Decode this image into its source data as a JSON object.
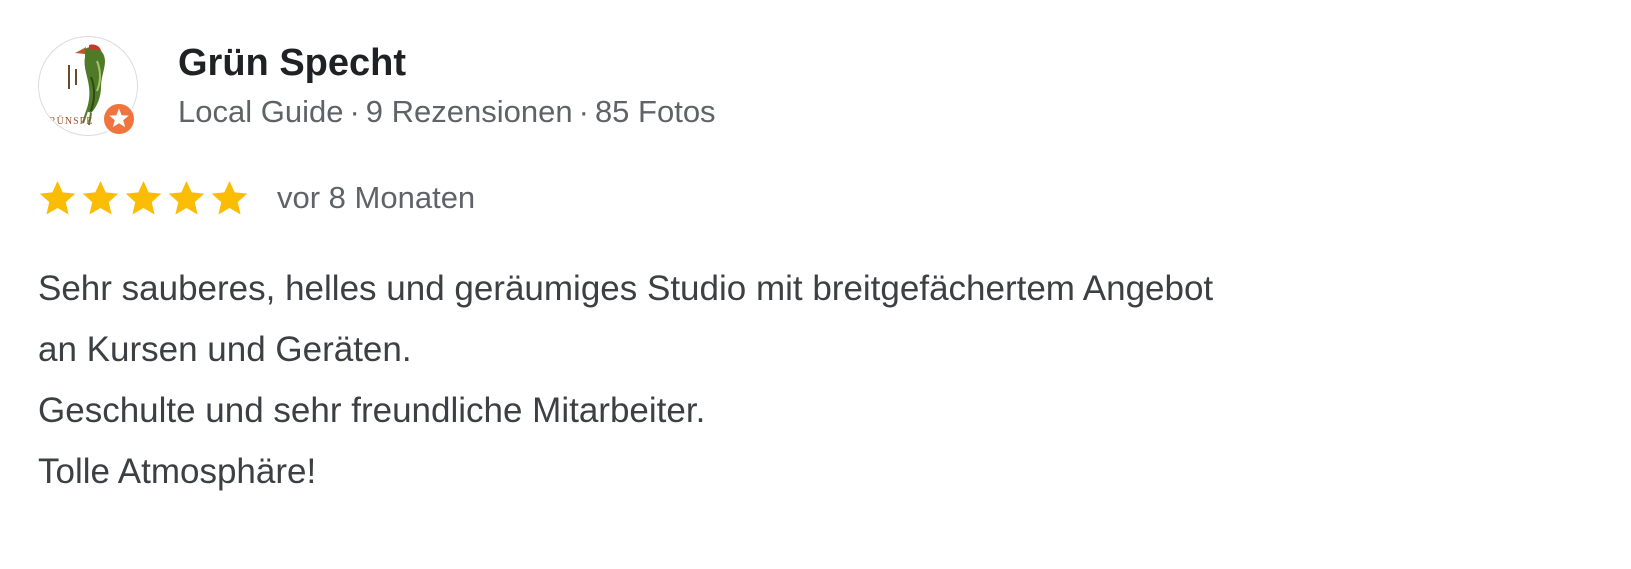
{
  "review": {
    "author": {
      "name": "Grün Specht",
      "avatar_text": "RÜNSPE",
      "level": "Local Guide",
      "separator": "·",
      "reviews": "9 Rezensionen",
      "photos": "85 Fotos"
    },
    "rating": {
      "value": 5,
      "max": 5,
      "star_color": "#fbbc04"
    },
    "time": "vor 8 Monaten",
    "text_lines": [
      "Sehr sauberes, helles und geräumiges Studio mit breitgefächertem Angebot",
      "an Kursen und Geräten.",
      "Geschulte und sehr freundliche Mitarbeiter.",
      "Tolle Atmosphäre!"
    ]
  },
  "colors": {
    "badge": "#f0743e",
    "logo_green": "#4f7a28"
  },
  "icons": {
    "avatar": "woodpecker-logo-icon",
    "badge": "local-guide-star-icon",
    "star": "star-filled-icon"
  }
}
